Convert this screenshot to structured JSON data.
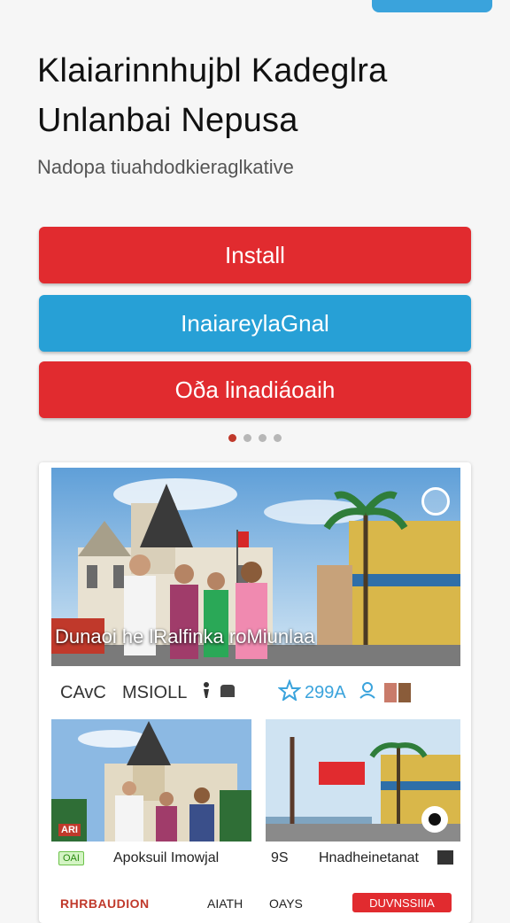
{
  "header": {
    "title": "Klaiarinnhujbl Kadeglra Unlanbai Nepusa",
    "subtitle": "Nadopa tiuahdodkieraglkative"
  },
  "buttons": {
    "install": "Install",
    "secondary": "InaiareylaGnal",
    "tertiary": "Oða linadiáoaih"
  },
  "pagination": {
    "total": 4,
    "active": 1
  },
  "card": {
    "hero_caption": "Dunaoi he lRalfinka roMiunlaa",
    "stats": {
      "left_label": "CAvC",
      "mid_label": "MSIOLL",
      "count": "299A"
    },
    "thumb1_label": "Apoksuil Imowjal",
    "thumb1_tag": "OAI",
    "thumb1_logo": "ARI",
    "thumb2_label": "Hnadheinetanat",
    "thumb2_prefix": "9S",
    "bottom": {
      "left": "RHRBAUDION",
      "mid1": "AIATH",
      "mid2": "OAYS",
      "pill": "DUVNSSIIIA"
    }
  },
  "colors": {
    "red": "#e12b2f",
    "blue": "#27a0d6",
    "dot_active": "#c0392b"
  }
}
